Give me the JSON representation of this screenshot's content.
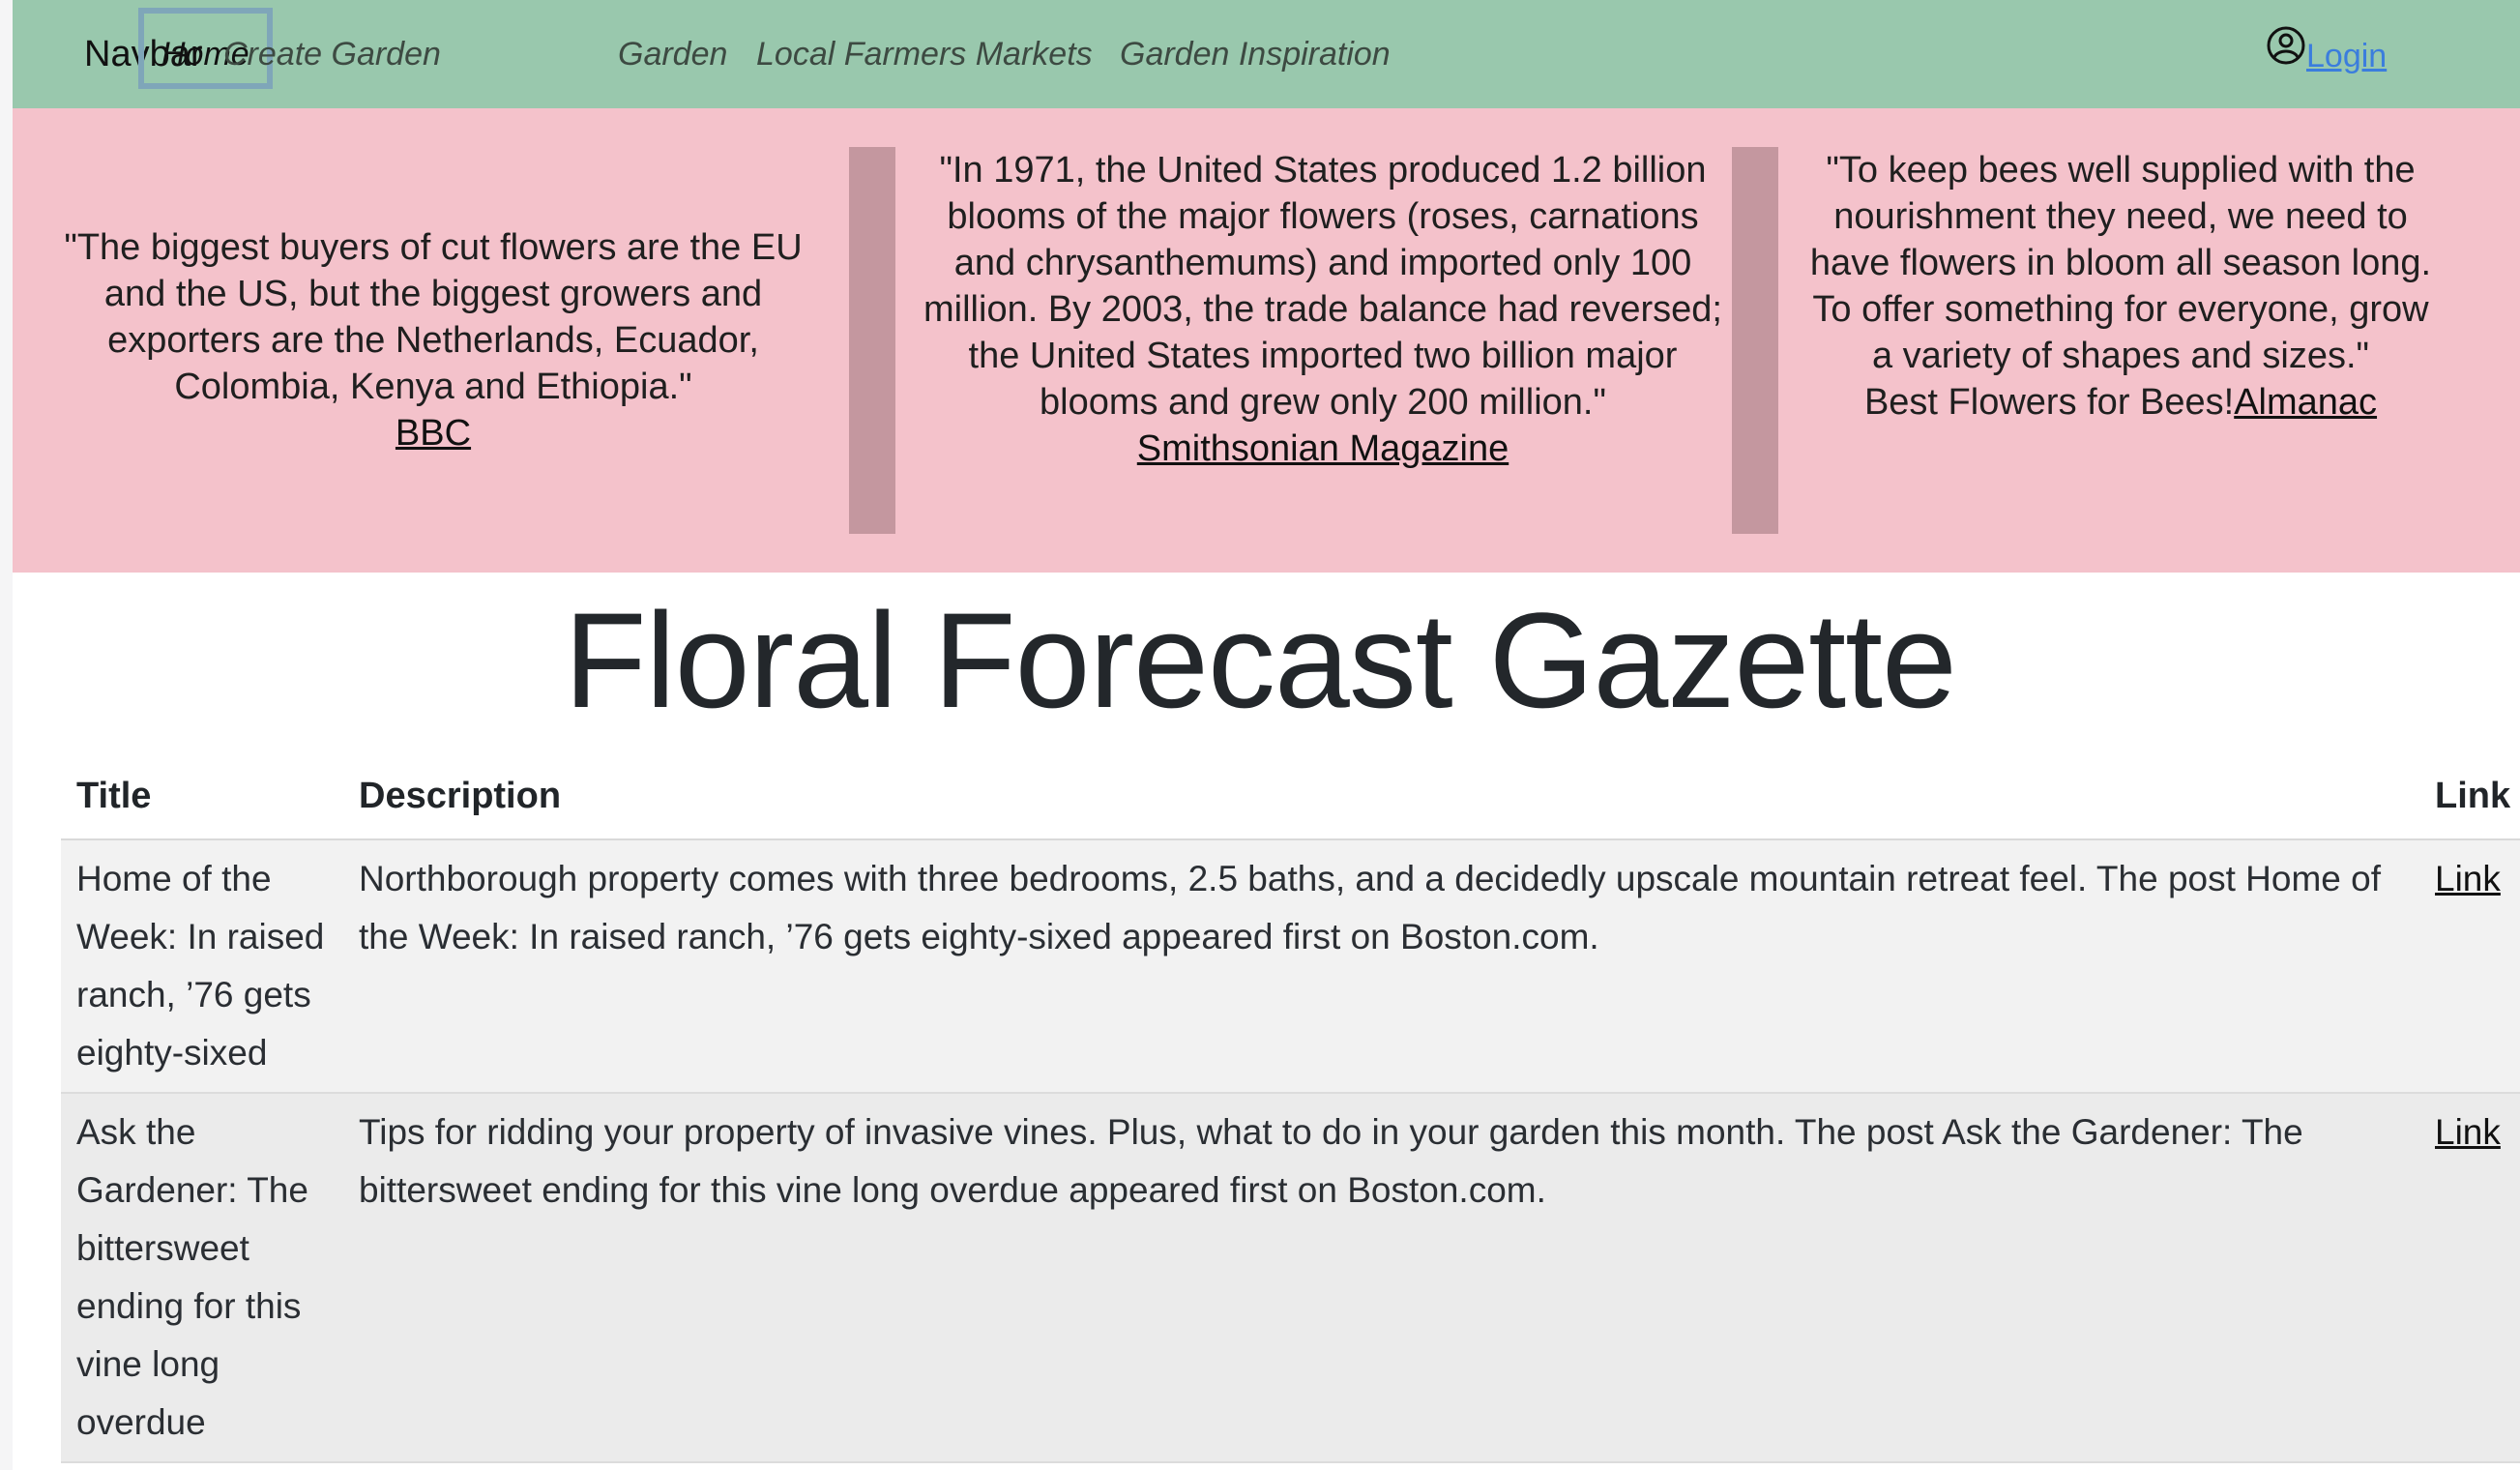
{
  "navbar": {
    "brand": "Navbar",
    "items": [
      {
        "label": "Home",
        "active": true
      },
      {
        "label": "Create Garden",
        "active": false
      },
      {
        "label": "Garden",
        "active": false
      },
      {
        "label": "Local Farmers Markets",
        "active": false
      },
      {
        "label": "Garden Inspiration",
        "active": false
      }
    ],
    "login_label": "Login",
    "login_icon": "user-circle-icon"
  },
  "quotes": [
    {
      "text": "\"The biggest buyers of cut flowers are the EU and the US, but the biggest growers and exporters are the Netherlands, Ecuador, Colombia, Kenya and Ethiopia.\"",
      "prefix": "",
      "source": "BBC"
    },
    {
      "text": "\"In 1971, the United States produced 1.2 billion blooms of the major flowers (roses, carnations and chrysanthemums) and imported only 100 million. By 2003, the trade balance had reversed; the United States imported two billion major blooms and grew only 200 million.\"",
      "prefix": "",
      "source": "Smithsonian Magazine"
    },
    {
      "text": "\"To keep bees well supplied with the nourishment they need, we need to have flowers in bloom all season long. To offer something for everyone, grow a variety of shapes and sizes.\"",
      "prefix": "Best Flowers for Bees!",
      "source": "Almanac"
    }
  ],
  "title": "Floral Forecast Gazette",
  "table": {
    "headers": [
      "Title",
      "Description",
      "Link"
    ],
    "rows": [
      {
        "title": "Home of the Week: In raised ranch, ’76 gets eighty-sixed",
        "description": "Northborough property comes with three bedrooms, 2.5 baths, and a decidedly upscale mountain retreat feel. The post Home of the Week: In raised ranch, ’76 gets eighty-sixed appeared first on Boston.com.",
        "link": "Link"
      },
      {
        "title": "Ask the Gardener: The bittersweet ending for this vine long overdue",
        "description": "Tips for ridding your property of invasive vines. Plus, what to do in your garden this month. The post Ask the Gardener: The bittersweet ending for this vine long overdue appeared first on Boston.com.",
        "link": "Link"
      }
    ]
  },
  "colors": {
    "navbar_bg": "#99c8ad",
    "banner_bg": "#f4c2cb",
    "divider": "#c4979f",
    "login_link": "#3b7ddd"
  }
}
